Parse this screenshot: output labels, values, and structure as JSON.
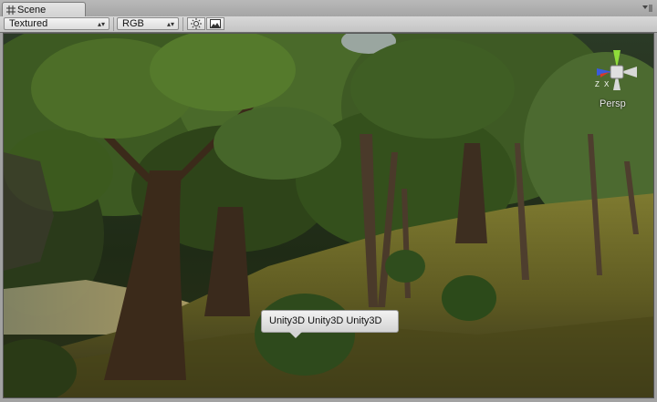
{
  "tab": {
    "title": "Scene",
    "icon": "scene-grid-icon"
  },
  "toolbar": {
    "render_mode": "Textured",
    "color_mode": "RGB",
    "buttons": [
      {
        "name": "scene-lighting-toggle",
        "icon": "sun-icon"
      },
      {
        "name": "scene-overlay-toggle",
        "icon": "image-icon"
      }
    ]
  },
  "gizmo": {
    "label": "Persp",
    "axes": [
      "Z",
      "X"
    ]
  },
  "tooltip": {
    "text": "Unity3D Unity3D Unity3D"
  },
  "colors": {
    "toolbar_bg": "#cfcfcf",
    "grass": "#6f6a24",
    "foliage": "#2f4a1a"
  }
}
